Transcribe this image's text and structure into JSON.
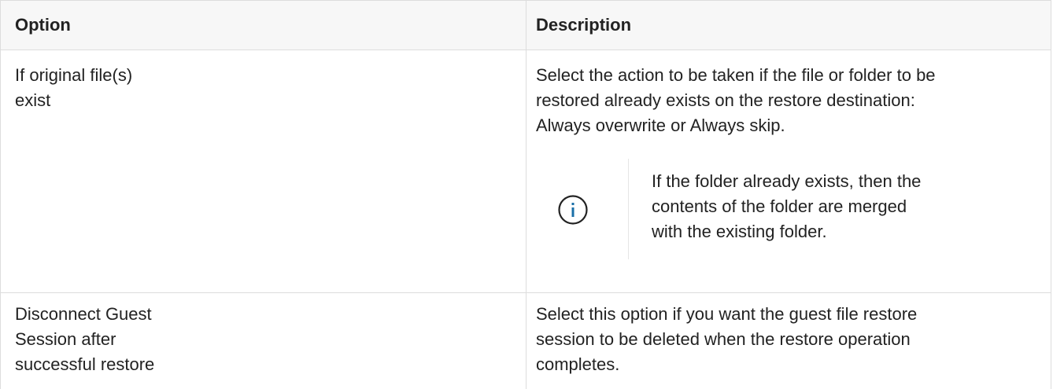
{
  "table": {
    "headers": [
      "Option",
      "Description"
    ],
    "rows": [
      {
        "option_lines": [
          "If original file(s)",
          "exist"
        ],
        "description_lines": [
          "Select the action to be taken if the file or folder to be",
          "restored already exists on the restore destination:",
          "Always overwrite or Always skip."
        ],
        "note": {
          "icon": "info-icon",
          "lines": [
            "If the folder already exists, then the",
            "contents of the folder are merged",
            "with the existing folder."
          ]
        }
      },
      {
        "option_lines": [
          "Disconnect Guest",
          "Session after",
          "successful restore"
        ],
        "description_lines": [
          "Select this option if you want the guest file restore",
          "session to be deleted when the restore operation",
          "completes."
        ]
      }
    ]
  },
  "colors": {
    "border": "#dddddd",
    "header_bg": "#f7f7f7",
    "icon": "#1a6fa8",
    "text": "#222222"
  }
}
